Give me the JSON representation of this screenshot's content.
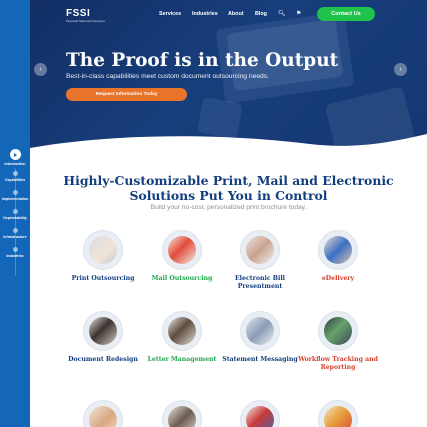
{
  "header": {
    "logo": "FSSI",
    "logo_tagline": "Financial Statement Services",
    "nav": [
      "Services",
      "Industries",
      "About",
      "Blog"
    ],
    "contact_label": "Contact Us"
  },
  "hero": {
    "title": "The Proof is in the Output",
    "subtitle": "Best-in-class capabilities meet custom document outsourcing needs.",
    "cta_label": "Request Information Today"
  },
  "sidebar": {
    "items": [
      {
        "label": "Introduction"
      },
      {
        "label": "Capabilities"
      },
      {
        "label": "Implementation"
      },
      {
        "label": "Dependability"
      },
      {
        "label": "Infrastructure"
      },
      {
        "label": "Industries"
      }
    ]
  },
  "main": {
    "title": "Highly-Customizable Print, Mail and Electronic Solutions Put You in Control",
    "subtitle": "Build your no-cost, personalized print brochure today."
  },
  "services": [
    {
      "label": "Print Outsourcing",
      "color": "#133e7e"
    },
    {
      "label": "Mail Outsourcing",
      "color": "#21a64b"
    },
    {
      "label": "Electronic Bill Presentment",
      "color": "#133e7e"
    },
    {
      "label": "eDelivery",
      "color": "#d6412b"
    },
    {
      "label": "Document Redesign",
      "color": "#133e7e"
    },
    {
      "label": "Letter Management",
      "color": "#21a64b"
    },
    {
      "label": "Statement Messaging",
      "color": "#133e7e"
    },
    {
      "label": "Workflow Tracking and Reporting",
      "color": "#d6412b"
    }
  ]
}
